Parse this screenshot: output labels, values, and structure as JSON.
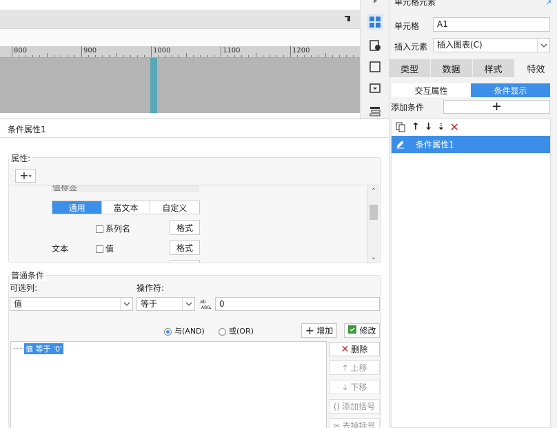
{
  "ruler": {
    "labels": [
      "800",
      "900",
      "1000",
      "1100",
      "1200"
    ]
  },
  "prop_panel": {
    "title": "条件属性1",
    "attributes": {
      "legend": "属性:",
      "add_icon": "plus-dropdown-icon",
      "truncated_label": "值标签",
      "format_tabs": [
        "通用",
        "富文本",
        "自定义"
      ],
      "series_name_label": "系列名",
      "format_btn_1": "格式",
      "text_label": "文本",
      "value_label": "值",
      "format_btn_2": "格式"
    },
    "conditions": {
      "legend": "普通条件",
      "column_label": "可选列:",
      "column_value": "值",
      "operator_label": "操作符:",
      "operator_value": "等于",
      "value_input": "0",
      "and_label": "与(AND)",
      "or_label": "或(OR)",
      "add_btn": "增加",
      "modify_btn": "修改",
      "condition_item": "值 等于 '0'",
      "delete_btn": "删除",
      "up_btn": "上移",
      "down_btn": "下移",
      "add_bracket_btn": "添加括号",
      "remove_bracket_btn": "去掉括号"
    }
  },
  "right_panel": {
    "title": "单元格元素",
    "cell_label": "单元格",
    "cell_value": "A1",
    "insert_label": "插入元素",
    "insert_value": "插入图表(C)",
    "tabs": [
      "类型",
      "数据",
      "样式",
      "特效"
    ],
    "sub_tabs": [
      "交互属性",
      "条件显示"
    ],
    "add_condition_label": "添加条件",
    "list_item": "条件属性1"
  },
  "colors": {
    "accent": "#3b8fe8",
    "delete": "#e02020"
  }
}
